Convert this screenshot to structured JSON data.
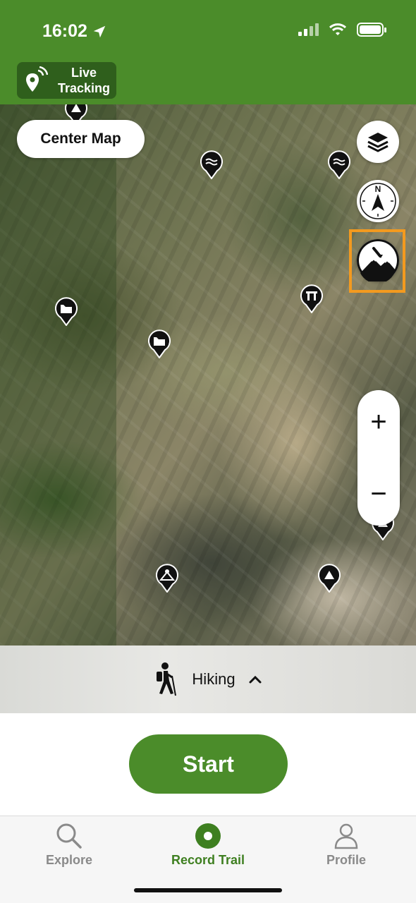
{
  "status_bar": {
    "time": "16:02"
  },
  "header": {
    "live_tracking_label": "Live Tracking"
  },
  "map": {
    "center_map_label": "Center Map",
    "controls": {
      "layers_icon": "layers-icon",
      "compass_label": "N",
      "terrain_icon": "terrain-3d-icon",
      "zoom_in_label": "+",
      "zoom_out_label": "−"
    },
    "highlight_color": "#f39a1f"
  },
  "activity": {
    "label": "Hiking",
    "icon": "hiker-icon"
  },
  "start_label": "Start",
  "tabs": [
    {
      "label": "Explore",
      "icon": "search-icon"
    },
    {
      "label": "Record Trail",
      "icon": "record-icon"
    },
    {
      "label": "Profile",
      "icon": "user-icon"
    }
  ],
  "colors": {
    "brand_green": "#4b8c2a",
    "dark_green": "#2f5f1c"
  }
}
